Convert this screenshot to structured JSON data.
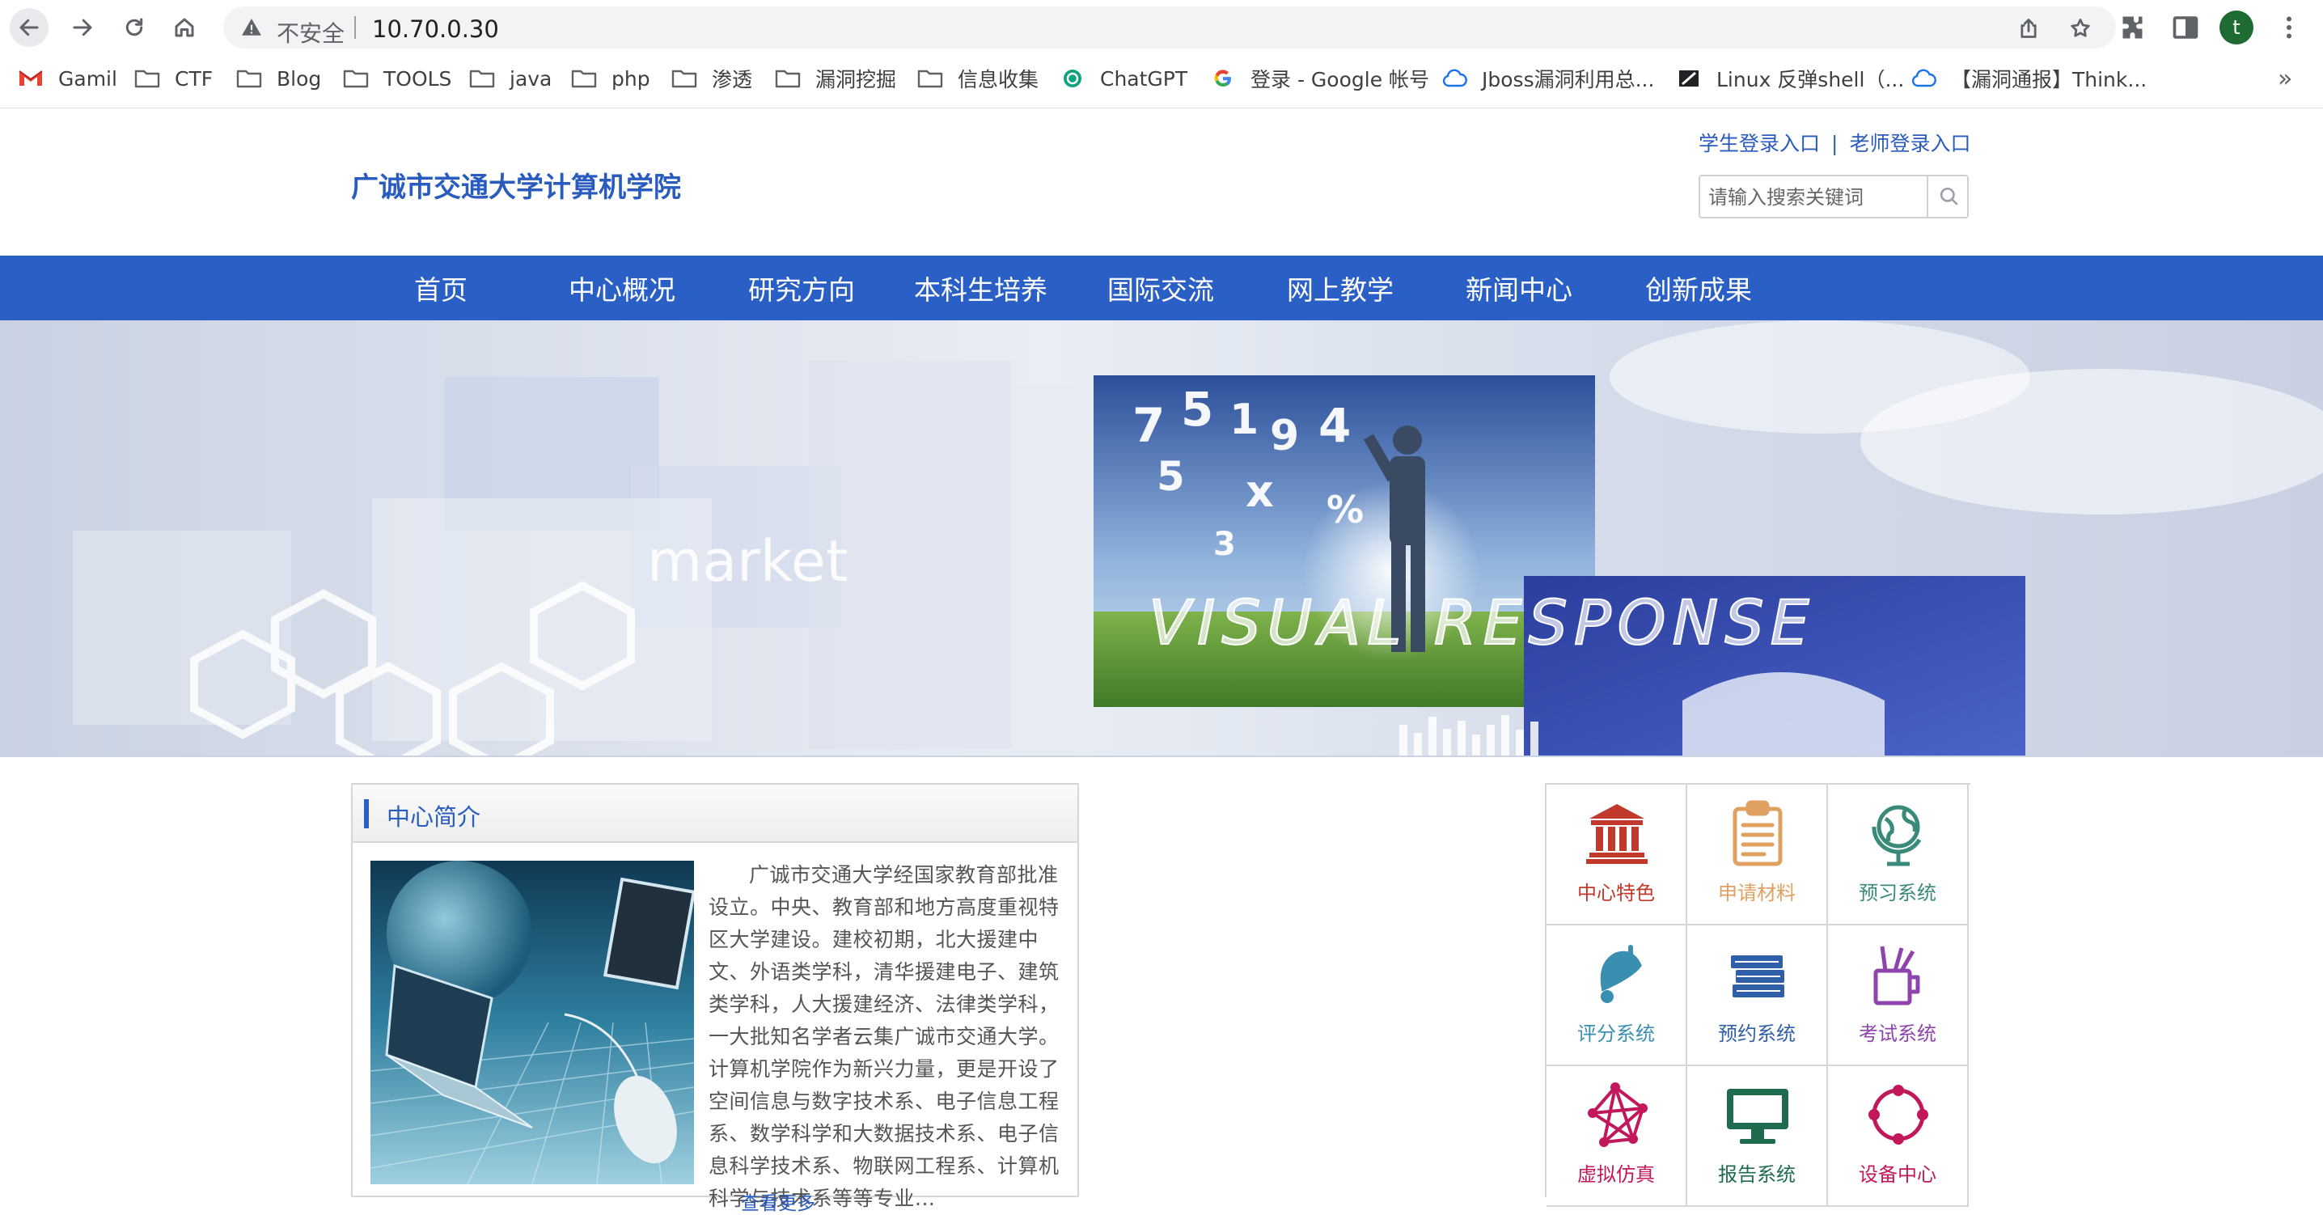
{
  "browser": {
    "security_label": "不安全",
    "url": "10.70.0.30",
    "profile_initial": "t",
    "bookmarks": [
      {
        "label": "Gamil",
        "icon": "gmail-icon"
      },
      {
        "label": "CTF",
        "icon": "folder-icon"
      },
      {
        "label": "Blog",
        "icon": "folder-icon"
      },
      {
        "label": "TOOLS",
        "icon": "folder-icon"
      },
      {
        "label": "java",
        "icon": "folder-icon"
      },
      {
        "label": "php",
        "icon": "folder-icon"
      },
      {
        "label": "渗透",
        "icon": "folder-icon"
      },
      {
        "label": "漏洞挖掘",
        "icon": "folder-icon"
      },
      {
        "label": "信息收集",
        "icon": "folder-icon"
      },
      {
        "label": "ChatGPT",
        "icon": "chatgpt-icon"
      },
      {
        "label": "登录 - Google 帐号",
        "icon": "google-icon"
      },
      {
        "label": "Jboss漏洞利用总...",
        "icon": "cloud-icon"
      },
      {
        "label": "Linux 反弹shell（...",
        "icon": "site-icon"
      },
      {
        "label": "【漏洞通报】Think...",
        "icon": "cloud-icon"
      }
    ],
    "more_label": "»"
  },
  "header": {
    "site_title": "广诚市交通大学计算机学院",
    "student_login": "学生登录入口",
    "separator": "|",
    "teacher_login": "老师登录入口",
    "search_placeholder": "请输入搜索关键词"
  },
  "nav": {
    "items": [
      "首页",
      "中心概况",
      "研究方向",
      "本科生培养",
      "国际交流",
      "网上教学",
      "新闻中心",
      "创新成果"
    ]
  },
  "banner": {
    "texts": [
      "market",
      "VISUAL RESPONSE"
    ]
  },
  "intro": {
    "title": "中心简介",
    "body": "广诚市交通大学经国家教育部批准设立。中央、教育部和地方高度重视特区大学建设。建校初期，北大援建中文、外语类学科，清华援建电子、建筑类学科，人大援建经济、法律类学科，一大批知名学者云集广诚市交通大学。计算机学院作为新兴力量，更是开设了空间信息与数字技术系、电子信息工程系、数学科学和大数据技术系、电子信息科学技术系、物联网工程系、计算机科学与技术系等等专业...",
    "more": "查看更多"
  },
  "services": [
    {
      "label": "中心特色",
      "icon": "museum-icon",
      "color": "#c0392b"
    },
    {
      "label": "申请材料",
      "icon": "clipboard-icon",
      "color": "#e0a060"
    },
    {
      "label": "预习系统",
      "icon": "globe-icon",
      "color": "#3a8a7a"
    },
    {
      "label": "评分系统",
      "icon": "bell-icon",
      "color": "#3a8fb0"
    },
    {
      "label": "预约系统",
      "icon": "books-icon",
      "color": "#2f5fa8"
    },
    {
      "label": "考试系统",
      "icon": "pencil-cup-icon",
      "color": "#8e44ad"
    },
    {
      "label": "虚拟仿真",
      "icon": "network-icon",
      "color": "#c2185b"
    },
    {
      "label": "报告系统",
      "icon": "monitor-icon",
      "color": "#1e6b4e"
    },
    {
      "label": "设备中心",
      "icon": "circle-nodes-icon",
      "color": "#c2185b"
    }
  ]
}
